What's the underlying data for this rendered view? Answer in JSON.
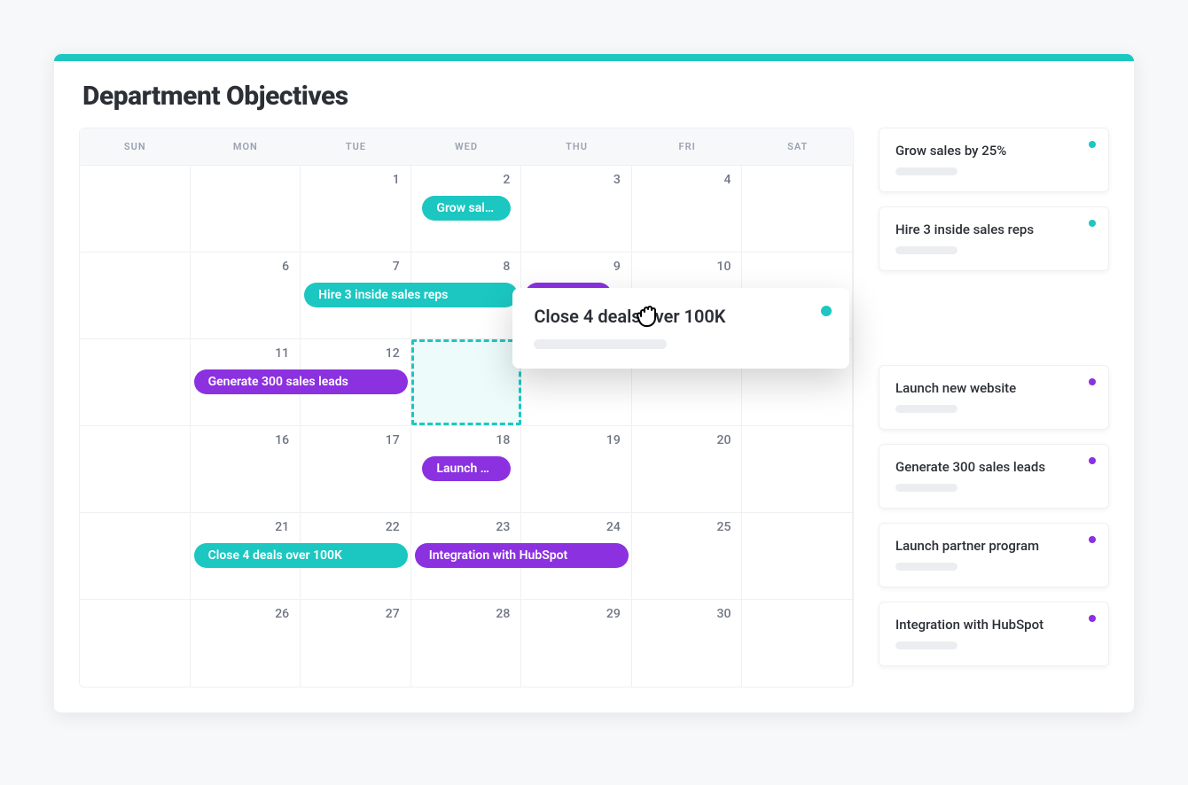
{
  "title": "Department Objectives",
  "colors": {
    "teal": "#1cc7c1",
    "purple": "#8b31e0"
  },
  "dow": [
    "SUN",
    "MON",
    "TUE",
    "WED",
    "THU",
    "FRI",
    "SAT"
  ],
  "weeks": [
    {
      "days": [
        "",
        "",
        "1",
        "2",
        "3",
        "4",
        ""
      ],
      "events": [
        {
          "label": "Grow sales b...",
          "color": "teal",
          "startCol": 3,
          "span": 1,
          "inset": true
        }
      ]
    },
    {
      "days": [
        "",
        "6",
        "7",
        "8",
        "9",
        "10",
        ""
      ],
      "events": [
        {
          "label": "Hire 3 inside sales reps",
          "color": "teal",
          "startCol": 2,
          "span": 2
        },
        {
          "label": "",
          "color": "purple",
          "startCol": 4,
          "span": 1,
          "stub": true
        }
      ]
    },
    {
      "days": [
        "",
        "11",
        "12",
        "",
        "",
        "",
        ""
      ],
      "events": [
        {
          "label": "Generate 300 sales leads",
          "color": "purple",
          "startCol": 1,
          "span": 2
        }
      ],
      "dropZone": {
        "col": 3
      }
    },
    {
      "days": [
        "",
        "16",
        "17",
        "18",
        "19",
        "20",
        ""
      ],
      "events": [
        {
          "label": "Launch part...",
          "color": "purple",
          "startCol": 3,
          "span": 1,
          "inset": true
        }
      ]
    },
    {
      "days": [
        "",
        "21",
        "22",
        "23",
        "24",
        "25",
        ""
      ],
      "events": [
        {
          "label": "Close 4 deals over 100K",
          "color": "teal",
          "startCol": 1,
          "span": 2
        },
        {
          "label": "Integration with HubSpot",
          "color": "purple",
          "startCol": 3,
          "span": 2
        }
      ]
    },
    {
      "days": [
        "",
        "26",
        "27",
        "28",
        "29",
        "30",
        ""
      ],
      "events": []
    }
  ],
  "dragCard": {
    "title": "Close 4 deals over 100K",
    "dot": "teal"
  },
  "sidebar": [
    {
      "title": "Grow sales by 25%",
      "dot": "teal"
    },
    {
      "title": "Hire 3 inside sales reps",
      "dot": "teal"
    },
    {
      "ghost": true
    },
    {
      "title": "Launch new website",
      "dot": "purple"
    },
    {
      "title": "Generate 300 sales leads",
      "dot": "purple"
    },
    {
      "title": "Launch partner program",
      "dot": "purple"
    },
    {
      "title": "Integration with HubSpot",
      "dot": "purple"
    }
  ]
}
